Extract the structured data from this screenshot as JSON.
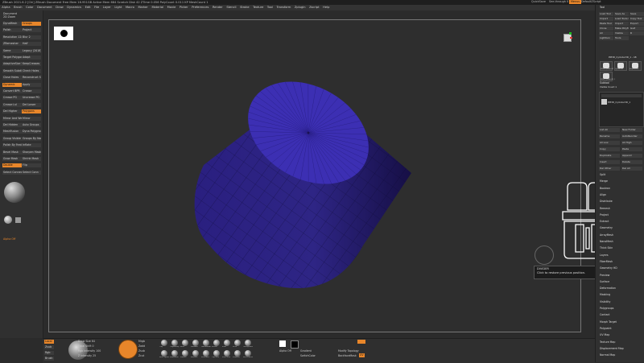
{
  "app": {
    "title": "ZBrush 2021.6.2 [Chi] ZBrush Document   Free Mem 16.951GB  Active Mem 684  Scratch Disk 42  ZTime 0.056  PolyCount 0.011 KP  MeshCount 1",
    "quicksave": "QuickSave",
    "see_through": "See-through 0",
    "menus": "Menus",
    "default_script": "DefaultZScript"
  },
  "menubar": [
    "Alpha",
    "Brush",
    "Color",
    "Document",
    "Draw",
    "Dynamics",
    "Edit",
    "File",
    "Layer",
    "Light",
    "Macro",
    "Marker",
    "Material",
    "Movie",
    "Picker",
    "Preferences",
    "Render",
    "Stencil",
    "Stroke",
    "Texture",
    "Tool",
    "Transform",
    "Zplugin",
    "Zscript",
    "Help"
  ],
  "left_panel": {
    "document_header": "Document",
    "zoom_label": "2D Zoom",
    "items": [
      "DynaMesh",
      "Groups",
      "Polish",
      "Project",
      "Resolution 128",
      "Blur 2",
      "ZRemesher",
      "Half",
      "Same",
      "Legacy (2018)",
      "Target Polygons Count 5",
      "Adapt",
      "AdaptiveSize 50",
      "KeepCreases",
      "Smooth Subdiv",
      "Check Holes",
      "Close Holes",
      "Reconstruct Subdiv",
      "Dynamic",
      "Apply",
      "Convert BPR",
      "Crease",
      "Crease PG",
      "Uncrease PG",
      "Crease Lvl",
      "Del Lower",
      "Del Higher",
      "Polygons",
      "Mirror And Weld",
      "Mirror",
      "Del Hidden",
      "Auto Groups",
      "MeshFusion",
      "Dyna Polygroup",
      "Group Visible",
      "Groups By Normals",
      "Polish By Features",
      "Inflate",
      "Bevel Mask",
      "Sharpen Mask",
      "Grow Mask",
      "Shrink Mask",
      "Double",
      "Flip",
      "Select Connect",
      "Select Conn"
    ],
    "stroke_label": "Free Hand",
    "alpha_label": "Alpha Off",
    "draw_size": "Draw Size 64",
    "material_label": "Flat Color"
  },
  "tool_panel": {
    "header": "Tool",
    "buttons": [
      "Load Tool",
      "Save As",
      "Save",
      "Import",
      "Load Tools From Project",
      "Copy Tool",
      "Paste Tool",
      "Import",
      "Export",
      "Clone",
      "Make PolyMesh3D",
      "GoZ",
      "All",
      "Visible",
      "R",
      "Lightbox",
      "Tools"
    ],
    "current_tool": "PM3D_Cylinder3D_1 - 48",
    "thumbnails": [
      "PM3D_Cylinder3D",
      "Cylinder3D",
      "SimpleBrush",
      "PM3D_Cylinder3D_1"
    ],
    "subtool_header": "Subtool",
    "subtool_visible_count": "Visible Count 1",
    "subtool_item": "PM3D_Cylinder3D_1",
    "subtool_buttons": [
      "List All",
      "New Folder",
      "Rename",
      "AutoReorder",
      "All Low",
      "All High",
      "Copy",
      "Paste",
      "Duplicate",
      "Append",
      "Insert",
      "Delete",
      "Del Other",
      "Del All"
    ],
    "sections": [
      "Split",
      "Merge",
      "Boolean",
      "Align",
      "Distribute",
      "Remesh",
      "Project",
      "Extract",
      "Geometry",
      "ArrayMesh",
      "NanoMesh",
      "Thick Skin",
      "Layers",
      "FiberMesh",
      "Geometry HD",
      "Preview",
      "Surface",
      "Deformation",
      "Masking",
      "Visibility",
      "Polygroups",
      "Contact",
      "Morph Target",
      "Polypaint",
      "UV Map",
      "Texture Map",
      "Displacement Map",
      "Normal Map"
    ]
  },
  "canvas": {
    "tooltip_title": "DIVIDER",
    "tooltip_text": "Click to restore previous position."
  },
  "bottom_bar": {
    "rows": [
      "Local",
      "Zsub",
      "Rgb",
      "Brush"
    ],
    "focal_shift": "Focal Shift 0",
    "draw_size": "Draw Size 64",
    "rgb_intensity": "Rgb Intensity 100",
    "z_intensity": "Z Intensity 25",
    "dynamic": "Dynamic",
    "mrgb": "Mrgb",
    "zadd": "Zadd",
    "zsub": "Zsub",
    "zcut": "Zcut",
    "brushes": [
      "Clay",
      "ClayBuildup",
      "Move",
      "Standard",
      "DamStandard",
      "hPolish",
      "Inflat",
      "Pinch",
      "TrimDynamic",
      "Move Topological",
      "SnakeHook",
      "Smooth",
      "MaskPen",
      "SelectRect",
      "ClipCurve",
      "SliceCurve",
      "ZModeler",
      "IMM Primitives"
    ],
    "alpha_label": "Alpha Off",
    "texture_label": "Texture Off",
    "gradient_label": "Gradient",
    "switch_color": "SwitchColor",
    "alternate": "Alternate",
    "backface_mask": "BackfaceMask",
    "weld_points": "Weld Points",
    "uv_label": "UV",
    "mirror_label": "Mirror",
    "modify_topology": "Modify Topology"
  },
  "colors": {
    "accent": "#e8862a",
    "cylinder_side": "#2e2585",
    "cylinder_top": "#3c2fb3"
  }
}
